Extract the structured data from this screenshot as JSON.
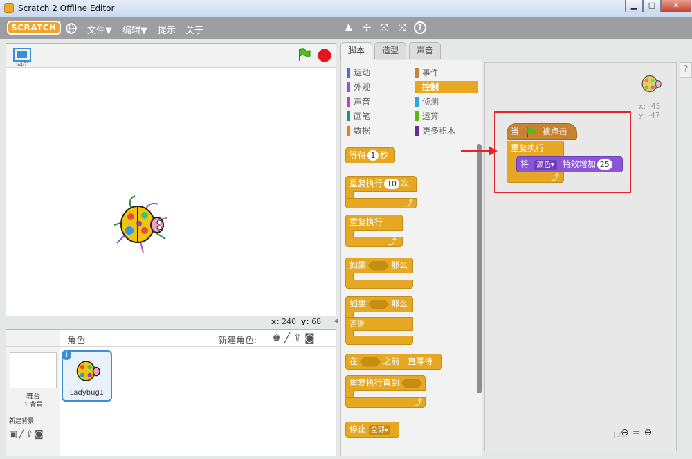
{
  "window": {
    "title": "Scratch 2 Offline Editor",
    "min": "▁",
    "max": "□",
    "close": "✕"
  },
  "menu": {
    "logo": "SCRATCH",
    "file": "文件▼",
    "edit": "编辑▼",
    "tips": "提示",
    "about": "关于"
  },
  "stage": {
    "version": "v461",
    "coord_x_label": "x:",
    "coord_x": "240",
    "coord_y_label": "y:",
    "coord_y": "68"
  },
  "sprites": {
    "header": "角色",
    "new_sprite": "新建角色:",
    "stage_label": "舞台",
    "backdrop_count": "1 背景",
    "new_backdrop": "新建背景",
    "sprite_name": "Ladybug1"
  },
  "tabs": [
    "脚本",
    "造型",
    "声音"
  ],
  "categories": {
    "left": [
      "运动",
      "外观",
      "声音",
      "画笔",
      "数据"
    ],
    "right": [
      "事件",
      "控制",
      "侦测",
      "运算",
      "更多积木"
    ],
    "colors_left": [
      "#4a6cd4",
      "#8a55d7",
      "#bb42c3",
      "#0e9a6c",
      "#ee7d16"
    ],
    "colors_right": [
      "#c88330",
      "#e1a91a",
      "#2ca5e2",
      "#5cb712",
      "#632d99"
    ],
    "selected": "控制"
  },
  "palette_blocks": {
    "wait": "等待",
    "wait_num": "1",
    "wait_unit": "秒",
    "repeat": "重复执行",
    "repeat_num": "10",
    "repeat_unit": "次",
    "forever": "重复执行",
    "if": "如果",
    "then": "那么",
    "if2": "如果",
    "then2": "那么",
    "else": "否则",
    "wait_until_a": "在",
    "wait_until_b": "之前一直等待",
    "repeat_until": "重复执行直到",
    "stop": "停止",
    "stop_opt": "全部▾"
  },
  "script": {
    "when": "当",
    "clicked": "被点击",
    "forever": "重复执行",
    "change": "将",
    "effect": "颜色▾",
    "effect_by": "特效增加",
    "value": "25"
  },
  "sprite_info": {
    "x": "x: -45",
    "y": "y: -47"
  },
  "watermark": "JU..."
}
